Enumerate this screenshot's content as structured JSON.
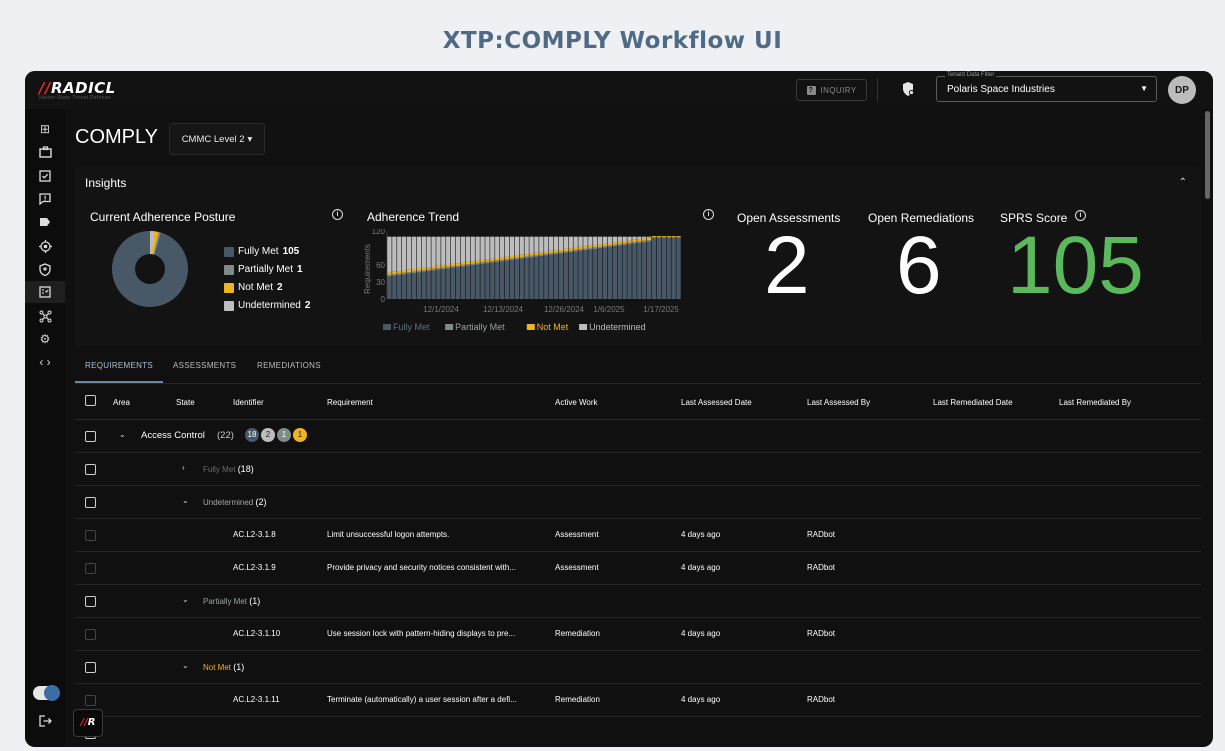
{
  "frame_title": "XTP:COMPLY Workflow UI",
  "brand": {
    "logo": "RADICL",
    "tagline": "Nation-State Threat Defense",
    "corner_logo": "R"
  },
  "header": {
    "inquiry_label": "INQUIRY",
    "tenant_label": "Tenant Data Filter",
    "tenant_value": "Polaris Space Industries",
    "avatar_initials": "DP"
  },
  "page": {
    "title": "COMPLY",
    "level_select": "CMMC Level 2"
  },
  "insights": {
    "title": "Insights",
    "posture": {
      "title": "Current Adherence Posture",
      "legend": [
        {
          "label": "Fully Met",
          "value": "105",
          "color": "#485867"
        },
        {
          "label": "Partially Met",
          "value": "1",
          "color": "#7f8b8a"
        },
        {
          "label": "Not Met",
          "value": "2",
          "color": "#f0b320"
        },
        {
          "label": "Undetermined",
          "value": "2",
          "color": "#bdbdbd"
        }
      ]
    },
    "trend": {
      "title": "Adherence Trend",
      "ylabel": "Requirements",
      "yticks": [
        "120",
        "60",
        "30",
        "0"
      ],
      "xticks": [
        "12/1/2024",
        "12/13/2024",
        "12/26/2024",
        "1/6/2025",
        "1/17/2025"
      ],
      "legend": [
        "Fully Met",
        "Partially Met",
        "Not Met",
        "Undetermined"
      ]
    },
    "stats": [
      {
        "label": "Open Assessments",
        "value": "2",
        "color": "#ffffff"
      },
      {
        "label": "Open Remediations",
        "value": "6",
        "color": "#ffffff"
      },
      {
        "label": "SPRS Score",
        "value": "105",
        "color": "#5cb85c"
      }
    ]
  },
  "chart_data": {
    "type": "bar",
    "title": "Adherence Trend",
    "ylabel": "Requirements",
    "ylim": [
      0,
      120
    ],
    "x_range": [
      "12/1/2024",
      "1/17/2025"
    ],
    "series": [
      {
        "name": "Fully Met",
        "color": "#485867",
        "start": 40,
        "end": 108
      },
      {
        "name": "Partially Met",
        "color": "#7f8b8a",
        "start": 3,
        "end": 1
      },
      {
        "name": "Not Met",
        "color": "#f0b320",
        "start": 4,
        "end": 2
      },
      {
        "name": "Undetermined",
        "color": "#bdbdbd",
        "start": 63,
        "end": 0
      }
    ]
  },
  "tabs": [
    "REQUIREMENTS",
    "ASSESSMENTS",
    "REMEDIATIONS"
  ],
  "table": {
    "headers": [
      "Area",
      "State",
      "Identifier",
      "Requirement",
      "Active Work",
      "Last Assessed Date",
      "Last Assessed By",
      "Last Remediated Date",
      "Last Remediated By"
    ],
    "group": {
      "name": "Access Control",
      "count": "(22)",
      "badges": [
        "18",
        "2",
        "1",
        "1"
      ]
    },
    "rows": [
      {
        "kind": "state",
        "state": "Fully Met",
        "count": "(18)",
        "caret": "›",
        "color": "#6a6a6a"
      },
      {
        "kind": "state",
        "state": "Undetermined",
        "count": "(2)",
        "caret": "⌄",
        "color": "#a6a6a6"
      },
      {
        "kind": "item",
        "id": "AC.L2-3.1.8",
        "requirement": "Limit unsuccessful logon attempts.",
        "work": "Assessment",
        "date": "4 days ago",
        "by": "RADbot"
      },
      {
        "kind": "item",
        "id": "AC.L2-3.1.9",
        "requirement": "Provide privacy and security notices consistent with...",
        "work": "Assessment",
        "date": "4 days ago",
        "by": "RADbot"
      },
      {
        "kind": "state",
        "state": "Partially Met",
        "count": "(1)",
        "caret": "⌄",
        "color": "#9aa3a3"
      },
      {
        "kind": "item",
        "id": "AC.L2-3.1.10",
        "requirement": "Use session lock with pattern-hiding displays to pre...",
        "work": "Remediation",
        "date": "4 days ago",
        "by": "RADbot"
      },
      {
        "kind": "state",
        "state": "Not Met",
        "count": "(1)",
        "caret": "⌄",
        "color": "#f0b320"
      },
      {
        "kind": "item",
        "id": "AC.L2-3.1.11",
        "requirement": "Terminate (automatically) a user session after a defi...",
        "work": "Remediation",
        "date": "4 days ago",
        "by": "RADbot"
      }
    ]
  }
}
